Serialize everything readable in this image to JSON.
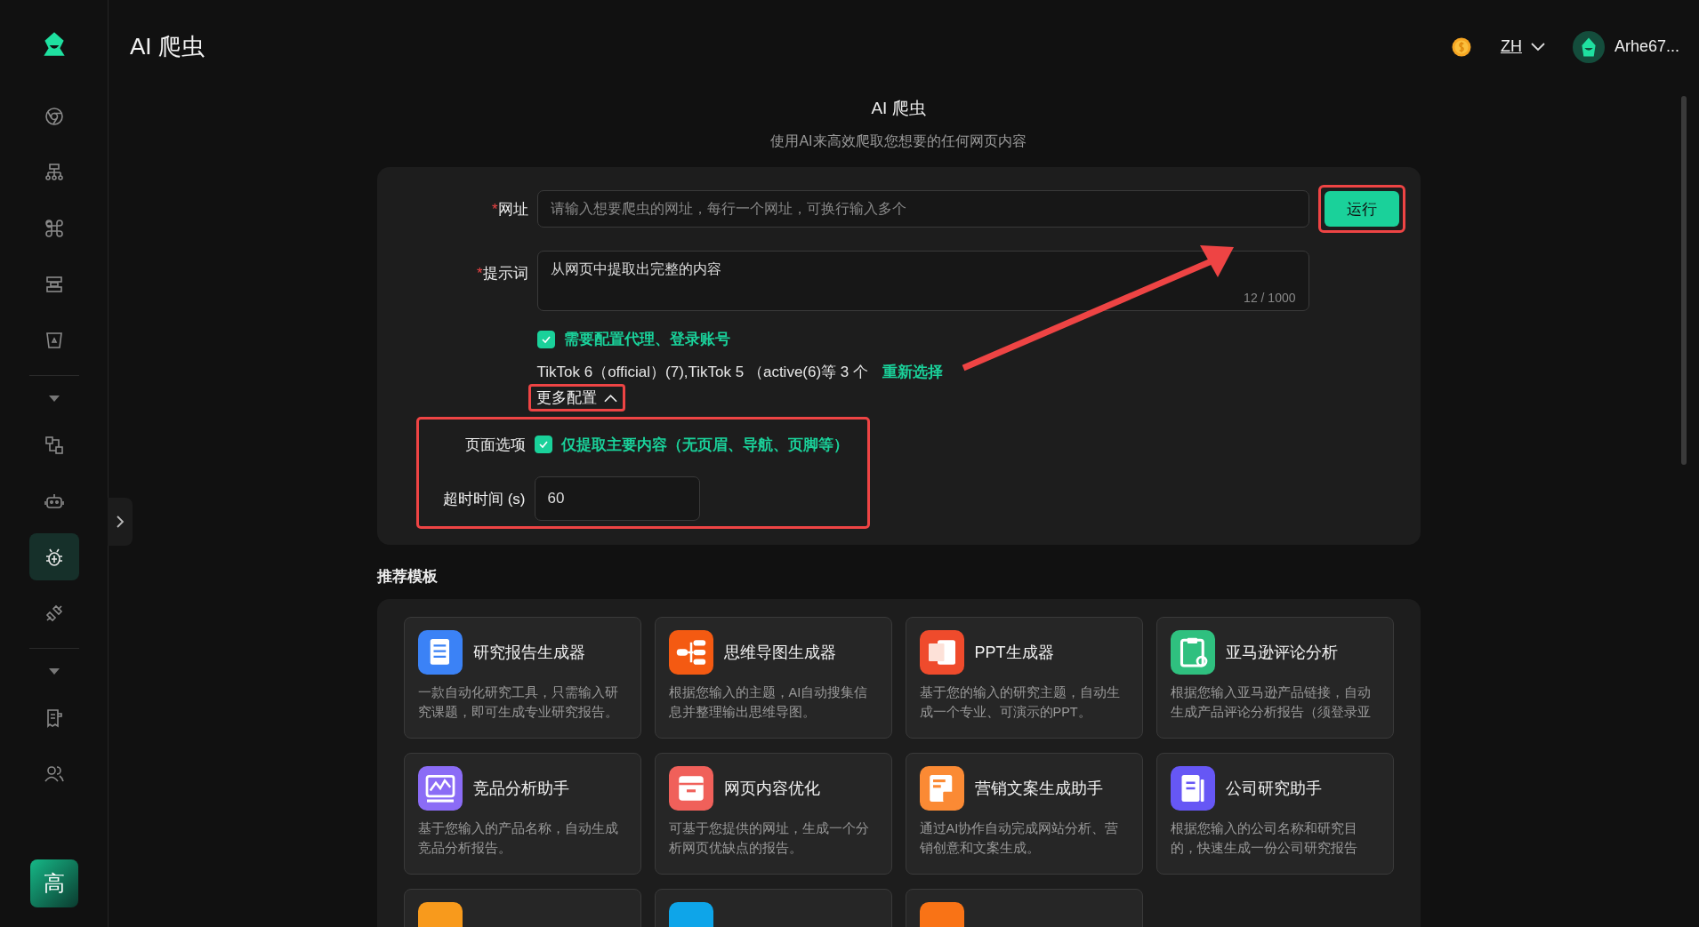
{
  "sidebar": {
    "groups": [
      {
        "collapsible": false,
        "items": [
          {
            "kind": "globe",
            "selected": false
          },
          {
            "kind": "sitemap",
            "selected": false
          },
          {
            "kind": "command",
            "selected": false
          },
          {
            "kind": "layout",
            "selected": false
          },
          {
            "kind": "bucket",
            "selected": false
          }
        ]
      },
      {
        "collapsible": true,
        "items": [
          {
            "kind": "flow",
            "selected": false
          },
          {
            "kind": "robot",
            "selected": false
          },
          {
            "kind": "bug",
            "selected": true
          },
          {
            "kind": "plug",
            "selected": false
          }
        ]
      },
      {
        "collapsible": true,
        "items": [
          {
            "kind": "document",
            "selected": false
          },
          {
            "kind": "users",
            "selected": false
          }
        ]
      }
    ],
    "badge": "高"
  },
  "header": {
    "title": "AI 爬虫",
    "language": "ZH",
    "user": "Arhe67..."
  },
  "page": {
    "title": "AI 爬虫",
    "subtitle": "使用AI来高效爬取您想要的任何网页内容"
  },
  "form": {
    "url": {
      "label": "网址",
      "required_mark": "*",
      "placeholder": "请输入想要爬虫的网址，每行一个网址，可换行输入多个"
    },
    "run_button": {
      "label": "运行",
      "highlighted": true
    },
    "prompt": {
      "label": "提示词",
      "required_mark": "*",
      "value": "从网页中提取出完整的内容",
      "counter": "12 / 1000"
    },
    "proxy": {
      "label": "需要配置代理、登录账号",
      "checked": true
    },
    "accounts": "TikTok 6（official）(7),TikTok 5 （active(6)等 3 个",
    "reselect": "重新选择",
    "more_config": {
      "label": "更多配置",
      "expanded": true,
      "highlighted": true
    },
    "advanced": {
      "highlighted": true,
      "page_option_label": "页面选项",
      "page_option": {
        "label": "仅提取主要内容（无页眉、导航、页脚等）",
        "checked": true
      },
      "timeout_label": "超时时间 (s)",
      "timeout": "60"
    },
    "annotation_arrow": true
  },
  "templates": {
    "title": "推荐模板",
    "items": [
      {
        "kind": "document",
        "color": "#3b82f6",
        "title": "研究报告生成器",
        "description": "一款自动化研究工具，只需输入研究课题，即可生成专业研究报告。"
      },
      {
        "kind": "mindmap",
        "color": "#f45a12",
        "title": "思维导图生成器",
        "description": "根据您输入的主题，AI自动搜集信息并整理输出思维导图。"
      },
      {
        "kind": "slides",
        "color": "#ef4b2c",
        "title": "PPT生成器",
        "description": "基于您的输入的研究主题，自动生成一个专业、可演示的PPT。"
      },
      {
        "kind": "clipboard",
        "color": "#2fc07f",
        "title": "亚马逊评论分析",
        "description": "根据您输入亚马逊产品链接，自动生成产品评论分析报告（须登录亚"
      },
      {
        "kind": "chart",
        "color": "#8b6cf6",
        "title": "竞品分析助手",
        "description": "基于您输入的产品名称，自动生成竞品分析报告。"
      },
      {
        "kind": "box",
        "color": "#f0605a",
        "title": "网页内容优化",
        "description": "可基于您提供的网址，生成一个分析网页优缺点的报告。"
      },
      {
        "kind": "ai-doc",
        "color": "#fb8a34",
        "title": "营销文案生成助手",
        "description": "通过AI协作自动完成网站分析、营销创意和文案生成。"
      },
      {
        "kind": "book",
        "color": "#6657f5",
        "title": "公司研究助手",
        "description": "根据您输入的公司名称和研究目的，快速生成一份公司研究报告"
      },
      {
        "kind": "blank",
        "color": "#f89a1c"
      },
      {
        "kind": "blank",
        "color": "#0ea5e9"
      },
      {
        "kind": "blank",
        "color": "#f97316"
      }
    ]
  }
}
